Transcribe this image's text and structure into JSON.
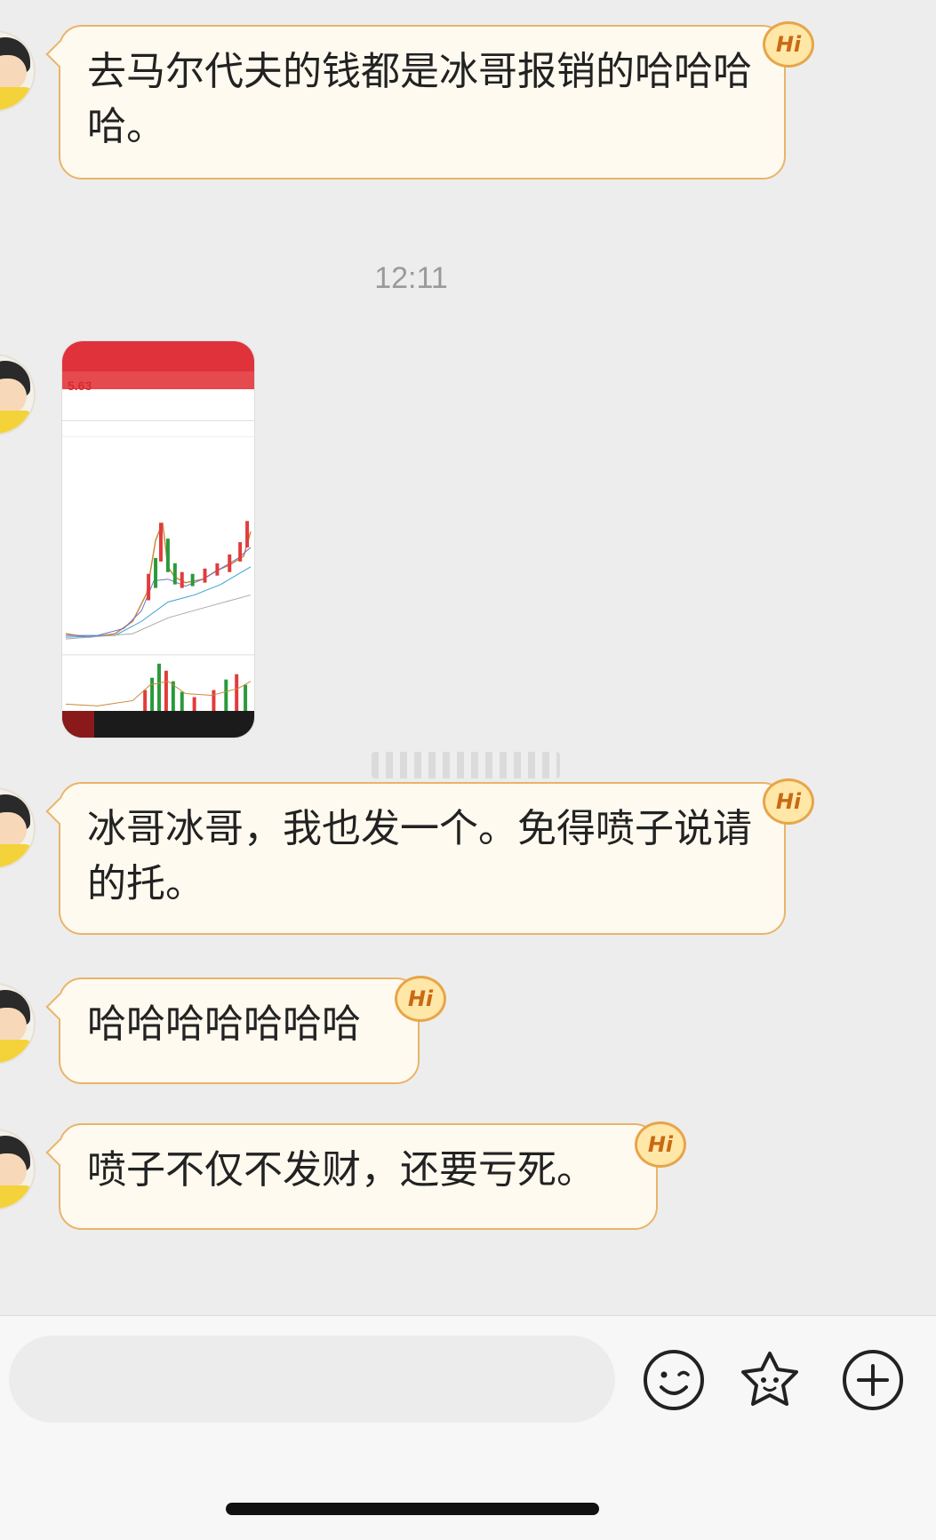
{
  "messages": [
    {
      "text": "去马尔代夫的钱都是冰哥报销的哈哈哈哈。",
      "badge": "Hi"
    },
    {
      "text": "冰哥冰哥，我也发一个。免得喷子说请的托。",
      "badge": "Hi"
    },
    {
      "text": "哈哈哈哈哈哈哈",
      "badge": "Hi"
    },
    {
      "text": "喷子不仅不发财，还要亏死。",
      "badge": "Hi"
    }
  ],
  "timestamp": "12:11",
  "image_message": {
    "price": "5.63"
  },
  "input": {
    "placeholder": "",
    "value": ""
  },
  "toolbar": {
    "icons": [
      "emoji-icon",
      "sticker-icon",
      "plus-icon"
    ]
  },
  "colors": {
    "bubble_bg": "#fffaf0",
    "bubble_border": "#e8b46a",
    "badge_text": "#c86a14",
    "chart_up": "#e23b3b",
    "chart_down": "#2a9a3a"
  }
}
